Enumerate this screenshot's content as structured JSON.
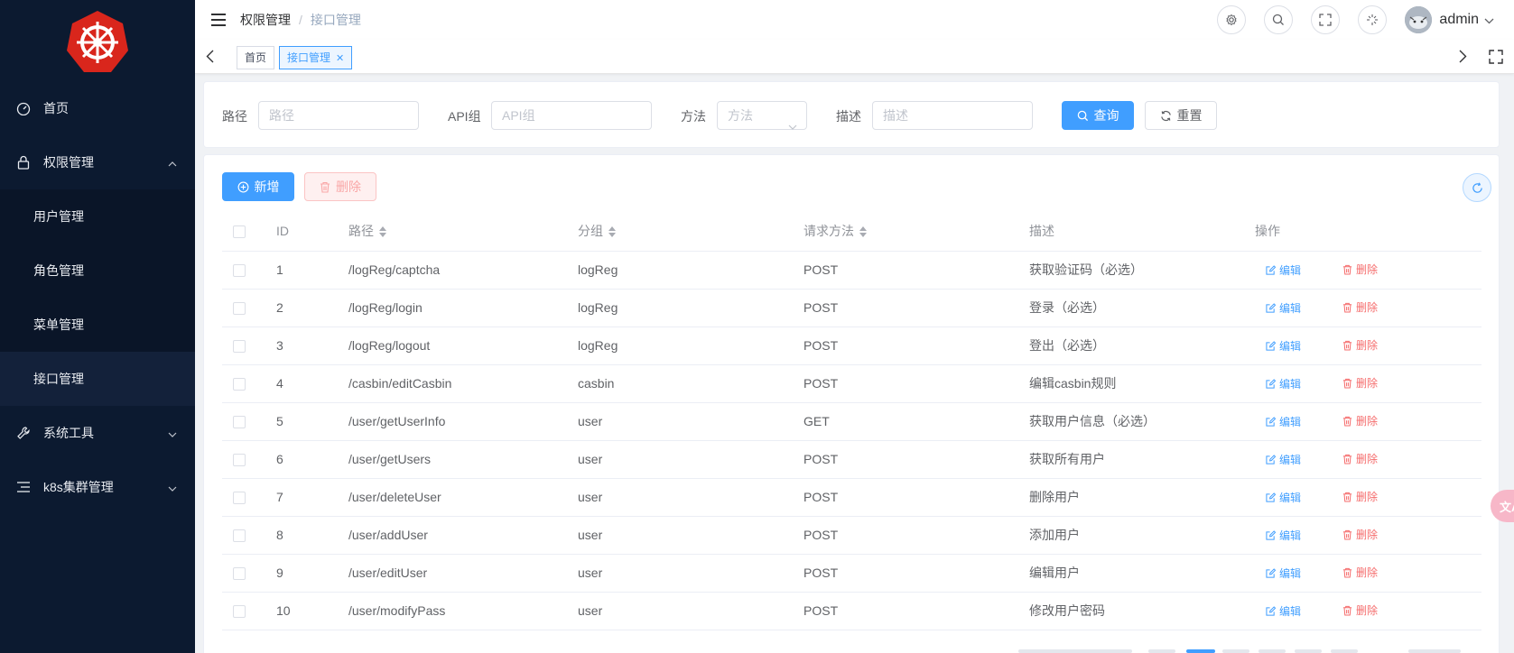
{
  "colors": {
    "sidebar_bg": "#0c1a30",
    "accent": "#409eff",
    "danger": "#f56c6c",
    "logo": "#d9261c"
  },
  "sidebar": {
    "logo_icon": "k8s-helm-icon",
    "items": [
      {
        "label": "首页",
        "icon": "dashboard-icon"
      },
      {
        "label": "权限管理",
        "icon": "lock-icon",
        "expanded": true,
        "children": [
          {
            "label": "用户管理"
          },
          {
            "label": "角色管理"
          },
          {
            "label": "菜单管理"
          },
          {
            "label": "接口管理",
            "active": true
          }
        ]
      },
      {
        "label": "系统工具",
        "icon": "wrench-icon"
      },
      {
        "label": "k8s集群管理",
        "icon": "list-icon"
      }
    ]
  },
  "header": {
    "breadcrumb": [
      "权限管理",
      "接口管理"
    ],
    "breadcrumb_sep": "/",
    "username": "admin"
  },
  "tags": {
    "home": "首页",
    "active": "接口管理"
  },
  "search": {
    "path_label": "路径",
    "path_placeholder": "路径",
    "group_label": "API组",
    "group_placeholder": "API组",
    "method_label": "方法",
    "method_placeholder": "方法",
    "desc_label": "描述",
    "desc_placeholder": "描述",
    "query_btn": "查询",
    "reset_btn": "重置"
  },
  "toolbar": {
    "add_btn": "新增",
    "delete_btn": "删除"
  },
  "table": {
    "columns": [
      "ID",
      "路径",
      "分组",
      "请求方法",
      "描述",
      "操作"
    ],
    "edit_label": "编辑",
    "delete_label": "删除",
    "rows": [
      {
        "id": "1",
        "path": "/logReg/captcha",
        "group": "logReg",
        "method": "POST",
        "desc": "获取验证码（必选）"
      },
      {
        "id": "2",
        "path": "/logReg/login",
        "group": "logReg",
        "method": "POST",
        "desc": "登录（必选）"
      },
      {
        "id": "3",
        "path": "/logReg/logout",
        "group": "logReg",
        "method": "POST",
        "desc": "登出（必选）"
      },
      {
        "id": "4",
        "path": "/casbin/editCasbin",
        "group": "casbin",
        "method": "POST",
        "desc": "编辑casbin规则"
      },
      {
        "id": "5",
        "path": "/user/getUserInfo",
        "group": "user",
        "method": "GET",
        "desc": "获取用户信息（必选）"
      },
      {
        "id": "6",
        "path": "/user/getUsers",
        "group": "user",
        "method": "POST",
        "desc": "获取所有用户"
      },
      {
        "id": "7",
        "path": "/user/deleteUser",
        "group": "user",
        "method": "POST",
        "desc": "删除用户"
      },
      {
        "id": "8",
        "path": "/user/addUser",
        "group": "user",
        "method": "POST",
        "desc": "添加用户"
      },
      {
        "id": "9",
        "path": "/user/editUser",
        "group": "user",
        "method": "POST",
        "desc": "编辑用户"
      },
      {
        "id": "10",
        "path": "/user/modifyPass",
        "group": "user",
        "method": "POST",
        "desc": "修改用户密码"
      }
    ]
  },
  "float_button": {
    "icon": "translate-icon"
  }
}
